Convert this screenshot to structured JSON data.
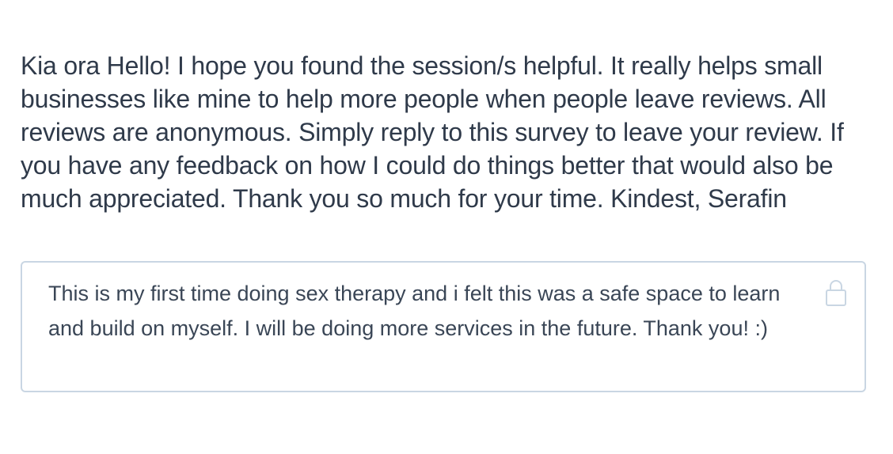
{
  "survey": {
    "prompt": "Kia ora Hello! I hope you found the session/s helpful. It really helps small businesses like mine to help more people when people leave reviews. All reviews are anonymous. Simply reply to this survey to leave your review. If you have any feedback on how I could do things better that would also be much appreciated. Thank you so much for your time. Kindest, Serafin",
    "response": "This is my first time doing sex therapy and i felt this was a safe space to learn and build on myself. I will be doing more services in the future. Thank you! :)",
    "lock_icon": "lock-icon",
    "colors": {
      "text": "#2f3a4a",
      "response_text": "#3a4656",
      "border": "#c9d6e3",
      "icon": "#c9d6e3"
    }
  }
}
